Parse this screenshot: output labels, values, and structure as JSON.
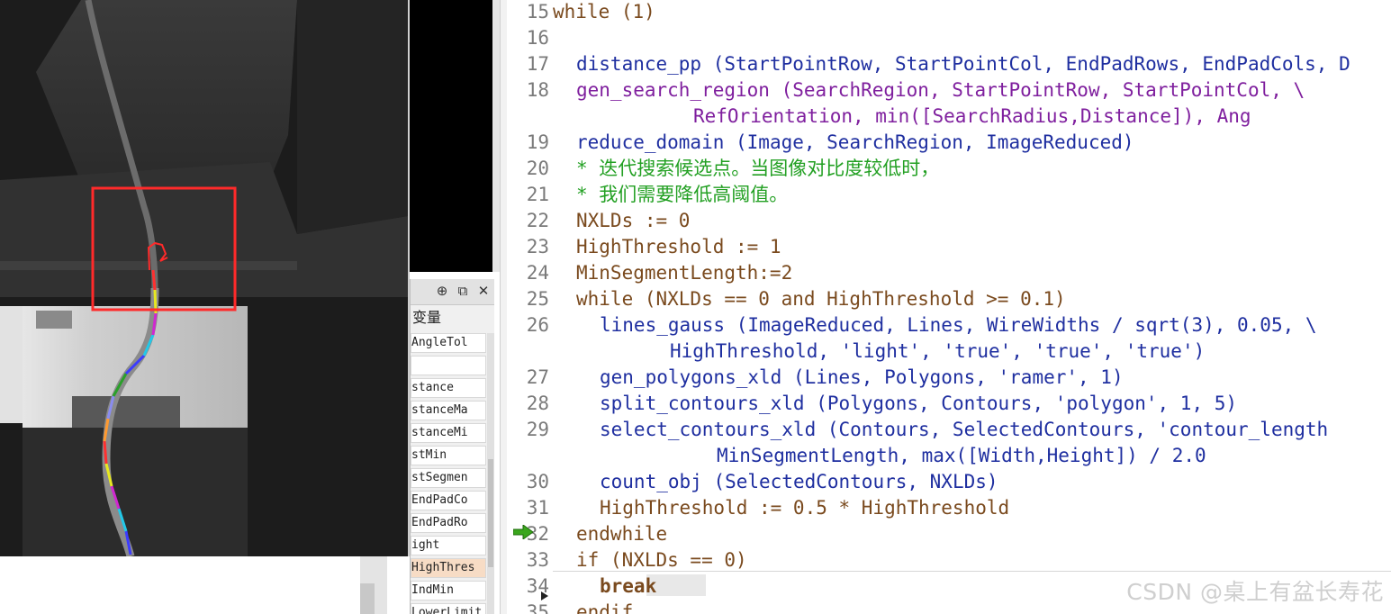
{
  "image_viewer": {
    "overlay_color": "#ff2a2a",
    "contour_colors": [
      "#3c3cff",
      "#22c8e8",
      "#d028d0",
      "#e8e820",
      "#ff3030",
      "#ff9a30",
      "#8a8cf0",
      "#2aa02a"
    ]
  },
  "variable_panel": {
    "title_icons": [
      "pin-icon",
      "float-window-icon",
      "close-icon"
    ],
    "section_label": "变量",
    "variables": [
      {
        "name": "AngleTol",
        "display": "AngleTol"
      },
      {
        "name": "",
        "display": ""
      },
      {
        "name": "Distance",
        "display": "stance"
      },
      {
        "name": "DistanceMax",
        "display": "stanceMa"
      },
      {
        "name": "DistanceMin",
        "display": "stanceMi"
      },
      {
        "name": "DistMin",
        "display": "stMin"
      },
      {
        "name": "DistSegment",
        "display": "stSegmen"
      },
      {
        "name": "EndPadCols",
        "display": "EndPadCo"
      },
      {
        "name": "EndPadRows",
        "display": "EndPadRo"
      },
      {
        "name": "Height",
        "display": "ight"
      },
      {
        "name": "HighThreshold",
        "display": "HighThres",
        "highlighted": true
      },
      {
        "name": "IndMin",
        "display": "IndMin"
      },
      {
        "name": "LowerLimit",
        "display": "LowerLimit"
      }
    ]
  },
  "editor": {
    "keyword_color": "#7a4a1e",
    "operator_color": "#1f2fa0",
    "argument_color": "#7f1f9e",
    "comment_color": "#23a023",
    "current_line_marker": "program-counter-arrow-icon",
    "lines": [
      {
        "num": "15",
        "indent": 0,
        "segments": [
          [
            "kw",
            "while"
          ],
          [
            "kw",
            " (1)"
          ]
        ]
      },
      {
        "num": "16",
        "indent": 0,
        "segments": []
      },
      {
        "num": "17",
        "indent": 1,
        "segments": [
          [
            "fn",
            "distance_pp"
          ],
          [
            "fn",
            " (StartPointRow, StartPointCol, EndPadRows, EndPadCols, D"
          ]
        ]
      },
      {
        "num": "18",
        "indent": 1,
        "segments": [
          [
            "arg",
            "gen_search_region"
          ],
          [
            "arg",
            " (SearchRegion, StartPointRow, StartPointCol, \\"
          ]
        ]
      },
      {
        "num": "",
        "indent": 6,
        "segments": [
          [
            "arg",
            "RefOrientation, min([SearchRadius,Distance]), Ang"
          ]
        ]
      },
      {
        "num": "19",
        "indent": 1,
        "segments": [
          [
            "fn",
            "reduce_domain"
          ],
          [
            "fn",
            " (Image, SearchRegion, ImageReduced)"
          ]
        ]
      },
      {
        "num": "20",
        "indent": 1,
        "segments": [
          [
            "cm",
            "* 迭代搜索候选点。当图像对比度较低时，"
          ]
        ]
      },
      {
        "num": "21",
        "indent": 1,
        "segments": [
          [
            "cm",
            "* 我们需要降低高阈值。"
          ]
        ]
      },
      {
        "num": "22",
        "indent": 1,
        "segments": [
          [
            "kw",
            "NXLDs := 0"
          ]
        ]
      },
      {
        "num": "23",
        "indent": 1,
        "segments": [
          [
            "kw",
            "HighThreshold := 1"
          ]
        ]
      },
      {
        "num": "24",
        "indent": 1,
        "segments": [
          [
            "kw",
            "MinSegmentLength:=2"
          ]
        ]
      },
      {
        "num": "25",
        "indent": 1,
        "segments": [
          [
            "kw",
            "while (NXLDs == 0 and HighThreshold >= 0.1)"
          ]
        ]
      },
      {
        "num": "26",
        "indent": 2,
        "segments": [
          [
            "fn",
            "lines_gauss"
          ],
          [
            "fn",
            " (ImageReduced, Lines, WireWidths / sqrt(3), 0.05, \\"
          ]
        ]
      },
      {
        "num": "",
        "indent": 5,
        "segments": [
          [
            "fn",
            "HighThreshold, 'light', 'true', 'true', 'true')"
          ]
        ]
      },
      {
        "num": "27",
        "indent": 2,
        "segments": [
          [
            "fn",
            "gen_polygons_xld"
          ],
          [
            "fn",
            " (Lines, Polygons, 'ramer', 1)"
          ]
        ]
      },
      {
        "num": "28",
        "indent": 2,
        "segments": [
          [
            "fn",
            "split_contours_xld"
          ],
          [
            "fn",
            " (Polygons, Contours, 'polygon', 1, 5)"
          ]
        ]
      },
      {
        "num": "29",
        "indent": 2,
        "segments": [
          [
            "fn",
            "select_contours_xld"
          ],
          [
            "fn",
            " (Contours, SelectedContours, 'contour_length"
          ]
        ]
      },
      {
        "num": "",
        "indent": 7,
        "segments": [
          [
            "fn",
            "MinSegmentLength, max([Width,Height]) / 2.0"
          ]
        ]
      },
      {
        "num": "30",
        "indent": 2,
        "segments": [
          [
            "fn",
            "count_obj"
          ],
          [
            "fn",
            " (SelectedContours, NXLDs)"
          ]
        ]
      },
      {
        "num": "31",
        "indent": 2,
        "segments": [
          [
            "kw",
            "HighThreshold := 0.5 * HighThreshold"
          ]
        ]
      },
      {
        "num": "32",
        "indent": 1,
        "segments": [
          [
            "kw",
            "endwhile"
          ]
        ],
        "current": true
      },
      {
        "num": "33",
        "indent": 1,
        "segments": [
          [
            "kw",
            "if (NXLDs == 0)"
          ]
        ]
      },
      {
        "num": "34",
        "indent": 2,
        "segments": [
          [
            "brk",
            "break"
          ]
        ]
      },
      {
        "num": "35",
        "indent": 1,
        "segments": [
          [
            "kw",
            "endif"
          ]
        ]
      }
    ]
  },
  "watermark": "CSDN @桌上有盆长寿花"
}
